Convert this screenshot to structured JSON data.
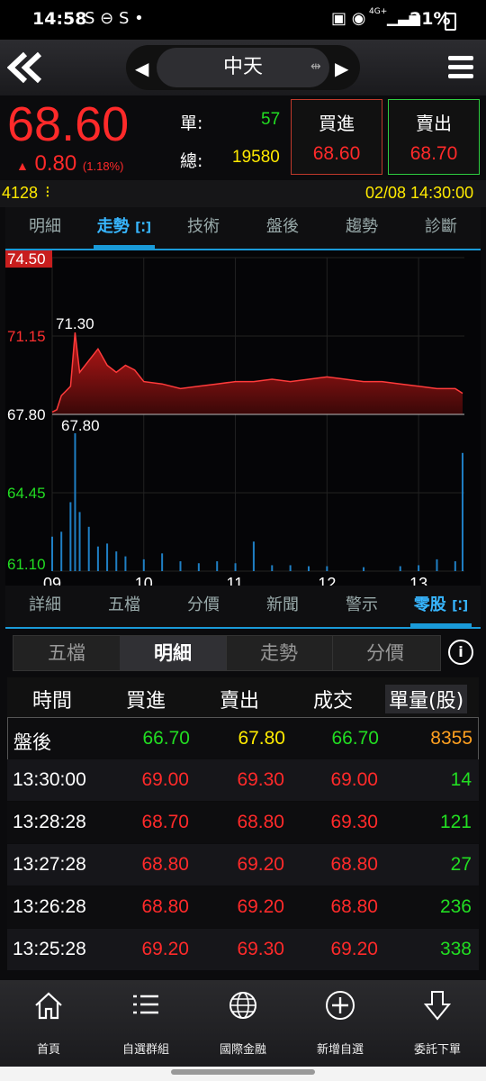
{
  "status": {
    "time": "14:58",
    "battery": "21%",
    "net": "4G+"
  },
  "header": {
    "title": "中天"
  },
  "quote": {
    "price": "68.60",
    "change": "0.80",
    "change_pct": "(1.18%)",
    "single_label": "單:",
    "single_value": "57",
    "total_label": "總:",
    "total_value": "19580",
    "buy_label": "買進",
    "buy_value": "68.60",
    "sell_label": "賣出",
    "sell_value": "68.70"
  },
  "strip": {
    "left": "4128",
    "datetime": "02/08 14:30:00"
  },
  "tabs_top": [
    "明細",
    "走勢",
    "技術",
    "盤後",
    "趨勢",
    "診斷"
  ],
  "chart_data": {
    "type": "area",
    "ylim": [
      61.1,
      74.5
    ],
    "y_ticks": [
      "74.50",
      "71.15",
      "67.80",
      "64.45",
      "61.10"
    ],
    "x_ticks": [
      "09",
      "10",
      "11",
      "12",
      "13"
    ],
    "high_label": "71.30",
    "low_label": "67.80",
    "reference": 67.8,
    "price": [
      [
        9.0,
        67.9
      ],
      [
        9.05,
        68.0
      ],
      [
        9.1,
        68.6
      ],
      [
        9.15,
        68.8
      ],
      [
        9.2,
        69.0
      ],
      [
        9.25,
        71.3
      ],
      [
        9.3,
        69.6
      ],
      [
        9.4,
        70.1
      ],
      [
        9.5,
        70.6
      ],
      [
        9.6,
        69.9
      ],
      [
        9.7,
        69.6
      ],
      [
        9.8,
        69.9
      ],
      [
        9.9,
        69.7
      ],
      [
        10.0,
        69.2
      ],
      [
        10.2,
        69.1
      ],
      [
        10.4,
        68.9
      ],
      [
        10.6,
        69.0
      ],
      [
        10.8,
        69.1
      ],
      [
        11.0,
        69.2
      ],
      [
        11.2,
        69.2
      ],
      [
        11.4,
        69.3
      ],
      [
        11.6,
        69.2
      ],
      [
        11.8,
        69.3
      ],
      [
        12.0,
        69.4
      ],
      [
        12.2,
        69.3
      ],
      [
        12.4,
        69.2
      ],
      [
        12.6,
        69.2
      ],
      [
        12.8,
        69.1
      ],
      [
        13.0,
        69.0
      ],
      [
        13.2,
        68.9
      ],
      [
        13.4,
        68.9
      ],
      [
        13.48,
        68.7
      ]
    ],
    "volume": [
      [
        9.0,
        35
      ],
      [
        9.1,
        40
      ],
      [
        9.2,
        70
      ],
      [
        9.25,
        140
      ],
      [
        9.3,
        60
      ],
      [
        9.4,
        45
      ],
      [
        9.5,
        25
      ],
      [
        9.6,
        28
      ],
      [
        9.7,
        20
      ],
      [
        9.8,
        15
      ],
      [
        10.0,
        12
      ],
      [
        10.2,
        18
      ],
      [
        10.4,
        10
      ],
      [
        10.6,
        8
      ],
      [
        10.8,
        10
      ],
      [
        11.0,
        8
      ],
      [
        11.2,
        30
      ],
      [
        11.4,
        6
      ],
      [
        11.6,
        6
      ],
      [
        11.8,
        5
      ],
      [
        12.0,
        5
      ],
      [
        12.4,
        4
      ],
      [
        12.8,
        5
      ],
      [
        13.0,
        6
      ],
      [
        13.2,
        12
      ],
      [
        13.4,
        10
      ],
      [
        13.48,
        120
      ]
    ]
  },
  "tabs_mid": [
    "詳細",
    "五檔",
    "分價",
    "新聞",
    "警示",
    "零股"
  ],
  "segments": [
    "五檔",
    "明細",
    "走勢",
    "分價"
  ],
  "table": {
    "headers": [
      "時間",
      "買進",
      "賣出",
      "成交",
      "單量(股)"
    ],
    "rows": [
      {
        "time": "盤後",
        "buy": "66.70",
        "sell": "67.80",
        "deal": "66.70",
        "vol": "8355"
      },
      {
        "time": "13:30:00",
        "buy": "69.00",
        "sell": "69.30",
        "deal": "69.00",
        "vol": "14"
      },
      {
        "time": "13:28:28",
        "buy": "68.70",
        "sell": "68.80",
        "deal": "69.30",
        "vol": "121"
      },
      {
        "time": "13:27:28",
        "buy": "68.80",
        "sell": "69.20",
        "deal": "68.80",
        "vol": "27"
      },
      {
        "time": "13:26:28",
        "buy": "68.80",
        "sell": "69.20",
        "deal": "68.80",
        "vol": "236"
      },
      {
        "time": "13:25:28",
        "buy": "69.20",
        "sell": "69.30",
        "deal": "69.20",
        "vol": "338"
      }
    ]
  },
  "nav": [
    "首頁",
    "自選群組",
    "國際金融",
    "新增自選",
    "委託下單"
  ],
  "colors": {
    "up": "#ff2a2a",
    "down": "#22dd22",
    "accent": "#1a9ad8",
    "yellow": "#ffea00"
  }
}
